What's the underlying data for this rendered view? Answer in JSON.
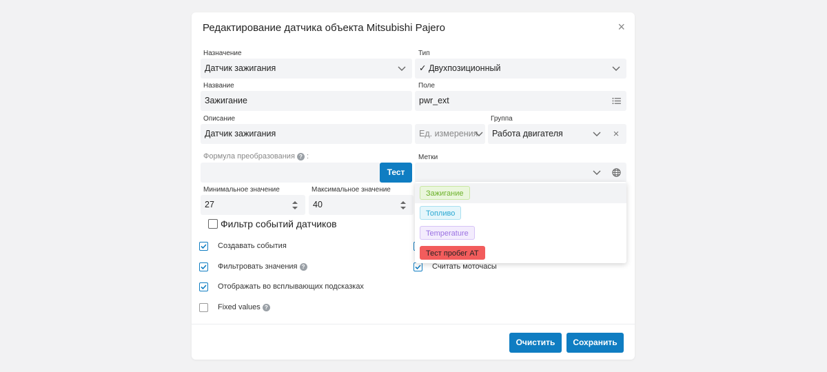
{
  "dialog": {
    "title": "Редактирование датчика объекта Mitsubishi Pajero"
  },
  "fields": {
    "purpose": {
      "label": "Назначение",
      "value": "Датчик зажигания"
    },
    "type": {
      "label": "Тип",
      "value": "✓ Двухпозиционный"
    },
    "name": {
      "label": "Название",
      "value": "Зажигание"
    },
    "field": {
      "label": "Поле",
      "value": "pwr_ext"
    },
    "description": {
      "label": "Описание",
      "value": "Датчик зажигания"
    },
    "unit": {
      "placeholder": "Ед. измерения"
    },
    "group": {
      "label": "Группа",
      "value": "Работа двигателя"
    },
    "formula": {
      "label": "Формула преобразования",
      "suffix": ":",
      "value": ""
    },
    "tags": {
      "label": "Метки"
    },
    "min": {
      "label": "Минимальное значение",
      "value": "27"
    },
    "max": {
      "label": "Максимальное значение",
      "value": "40"
    }
  },
  "buttons": {
    "test": "Тест",
    "clear": "Очистить",
    "save": "Сохранить"
  },
  "filter_label": "Фильтр событий датчиков",
  "checkboxes": [
    {
      "label": "Создавать события",
      "checked": true
    },
    {
      "label": "Фильтровать значения",
      "checked": true
    },
    {
      "label": "Отображать во всплывающих подсказках",
      "checked": true
    },
    {
      "label": "Fixed values",
      "checked": false
    },
    {
      "label": "Считать моточасы",
      "checked": true
    }
  ],
  "tag_options": [
    {
      "label": "Зажигание",
      "bg": "#eaf6dc",
      "border": "#c9e7a3",
      "color": "#6cb22a"
    },
    {
      "label": "Топливо",
      "bg": "#e5f6fb",
      "border": "#a9dff0",
      "color": "#2aa8d2"
    },
    {
      "label": "Temperature",
      "bg": "#f3ecfd",
      "border": "#d6c3f7",
      "color": "#9a70e2"
    },
    {
      "label": "Тест пробег АТ",
      "bg": "#f25c5c",
      "border": "#f25c5c",
      "color": "#222222"
    }
  ],
  "colors": {
    "accent": "#0f7dc2",
    "field_bg": "#f3f4f6"
  },
  "icons": {
    "close": "close-icon",
    "list": "list-icon",
    "globe": "globe-icon",
    "help": "help-icon",
    "chevron": "chevron-down-icon"
  }
}
